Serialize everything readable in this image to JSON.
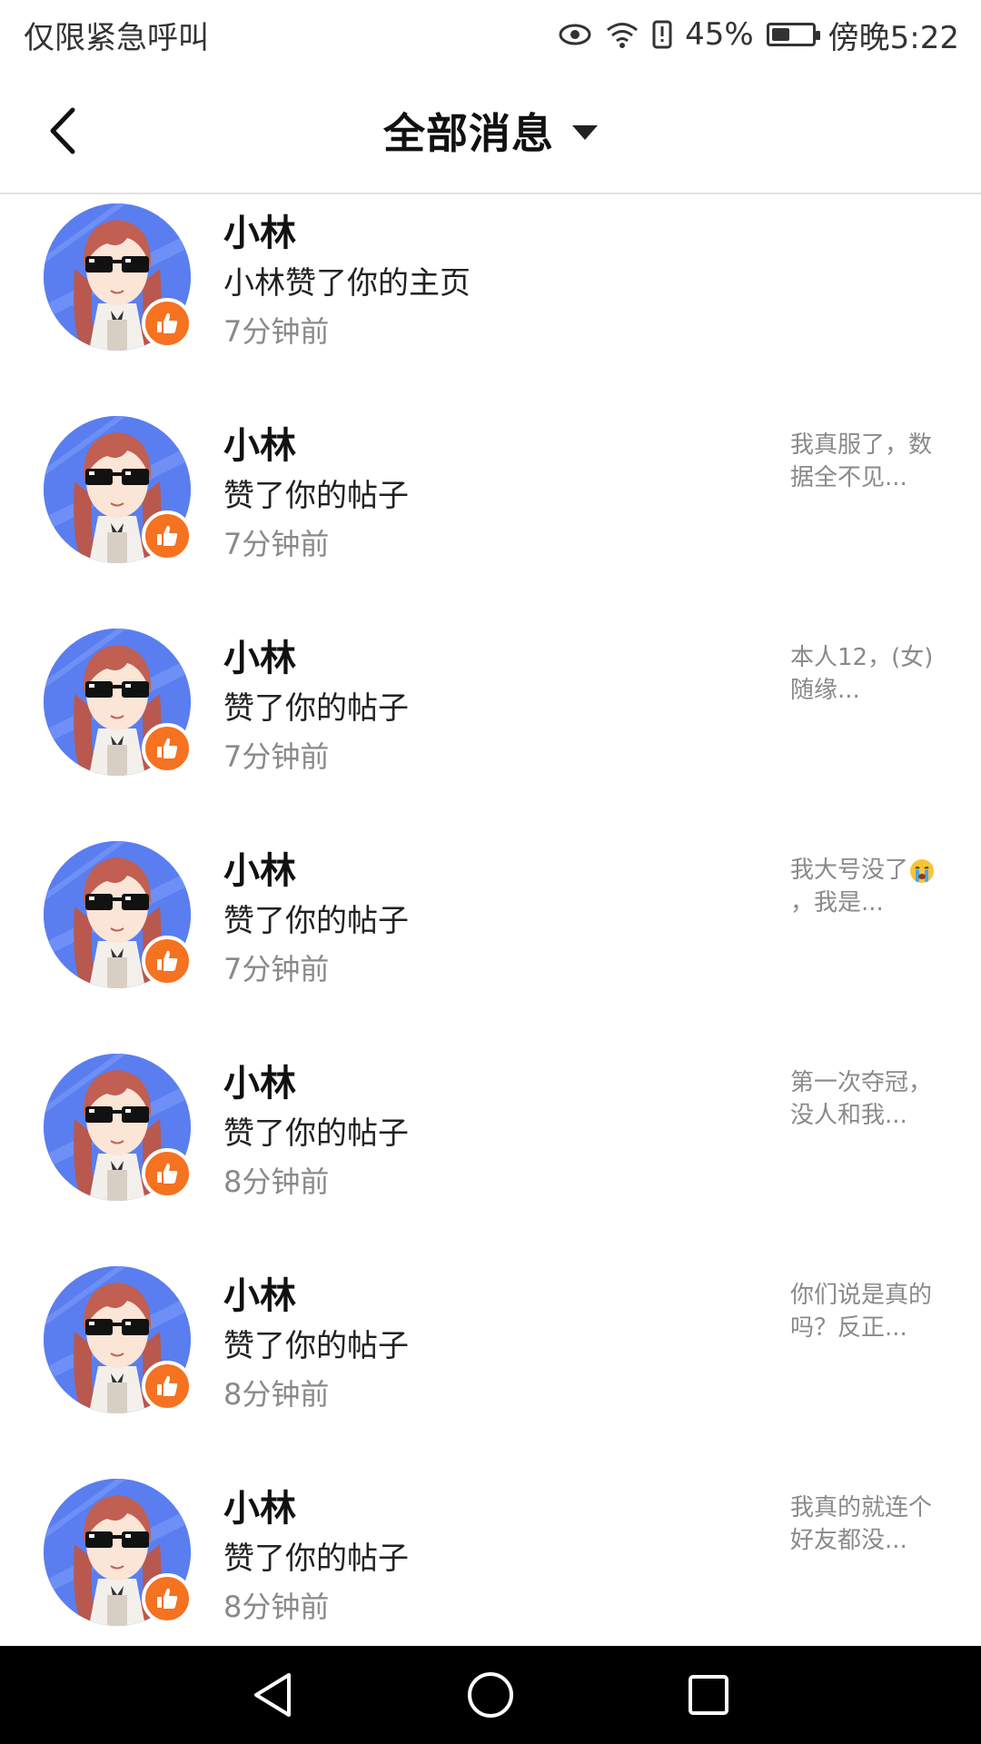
{
  "status_bar": {
    "left_text": "仅限紧急呼叫",
    "battery_percent": "45%",
    "battery_level": 0.45,
    "time": "傍晚5:22",
    "icons": [
      "eye-icon",
      "wifi-icon",
      "alert-icon",
      "battery-icon"
    ]
  },
  "header": {
    "title": "全部消息",
    "back_icon": "back-arrow-icon",
    "dropdown_icon": "caret-down-icon"
  },
  "colors": {
    "accent": "#f57221",
    "avatar_bg": "#5a7ef0",
    "muted_text": "#8a8a8a"
  },
  "items": [
    {
      "name": "小林",
      "action": "小林赞了你的主页",
      "time": "7分钟前",
      "preview": ""
    },
    {
      "name": "小林",
      "action": "赞了你的帖子",
      "time": "7分钟前",
      "preview": "我真服了，数据全不见..."
    },
    {
      "name": "小林",
      "action": "赞了你的帖子",
      "time": "7分钟前",
      "preview": "本人12，(女)随缘..."
    },
    {
      "name": "小林",
      "action": "赞了你的帖子",
      "time": "7分钟前",
      "preview_pre": "我大号没了",
      "preview_post": "，我是...",
      "preview_emoji": "crying-face-emoji"
    },
    {
      "name": "小林",
      "action": "赞了你的帖子",
      "time": "8分钟前",
      "preview": "第一次夺冠，没人和我..."
    },
    {
      "name": "小林",
      "action": "赞了你的帖子",
      "time": "8分钟前",
      "preview": "你们说是真的吗？反正..."
    },
    {
      "name": "小林",
      "action": "赞了你的帖子",
      "time": "8分钟前",
      "preview": "我真的就连个好友都没..."
    }
  ],
  "nav_bar": {
    "icons": [
      "nav-back-icon",
      "nav-home-icon",
      "nav-recents-icon"
    ]
  }
}
